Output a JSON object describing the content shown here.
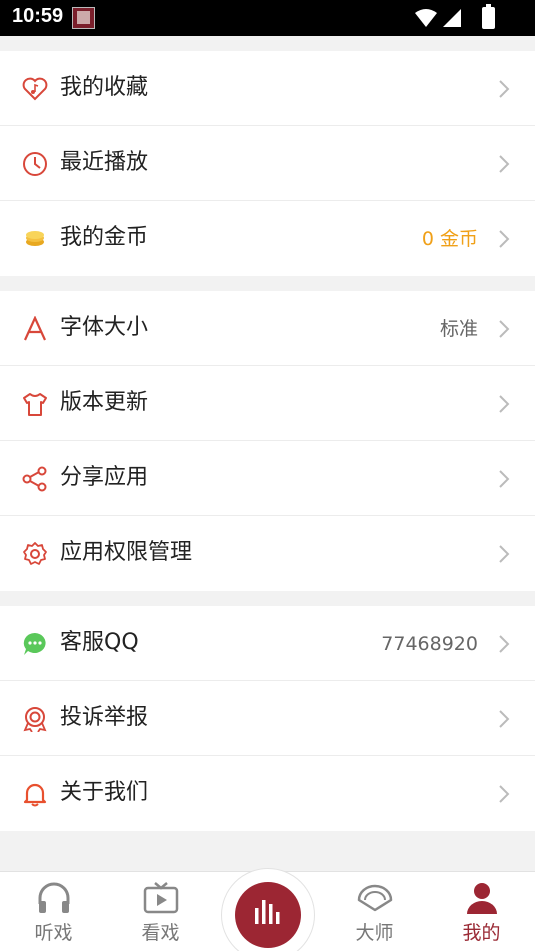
{
  "status_bar": {
    "time": "10:59"
  },
  "menu": {
    "favorites": {
      "label": "我的收藏"
    },
    "recent": {
      "label": "最近播放"
    },
    "coins": {
      "label": "我的金币",
      "value": "0 金币"
    },
    "font_size": {
      "label": "字体大小",
      "value": "标准"
    },
    "update": {
      "label": "版本更新"
    },
    "share": {
      "label": "分享应用"
    },
    "permissions": {
      "label": "应用权限管理"
    },
    "service_qq": {
      "label": "客服QQ",
      "value": "77468920"
    },
    "report": {
      "label": "投诉举报"
    },
    "about": {
      "label": "关于我们"
    }
  },
  "tabbar": {
    "listen": "听戏",
    "watch": "看戏",
    "master": "大师",
    "mine": "我的"
  },
  "colors": {
    "accent": "#9c2633",
    "icon_red": "#d8473a",
    "gold": "#f0a018",
    "green": "#5ac85a"
  }
}
